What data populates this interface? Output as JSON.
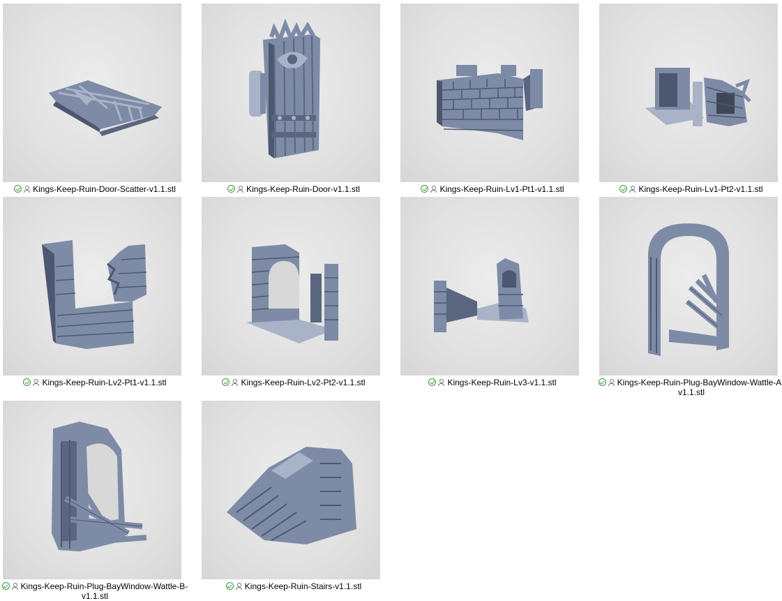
{
  "files": [
    {
      "name": "Kings-Keep-Ruin-Door-Scatter-v1.1.stl",
      "status_icon": "sync-ok-icon",
      "owner_icon": "person-icon",
      "thumb": "door-scatter"
    },
    {
      "name": "Kings-Keep-Ruin-Door-v1.1.stl",
      "status_icon": "sync-ok-icon",
      "owner_icon": "person-icon",
      "thumb": "door"
    },
    {
      "name": "Kings-Keep-Ruin-Lv1-Pt1-v1.1.stl",
      "status_icon": "sync-ok-icon",
      "owner_icon": "person-icon",
      "thumb": "lv1-pt1"
    },
    {
      "name": "Kings-Keep-Ruin-Lv1-Pt2-v1.1.stl",
      "status_icon": "sync-ok-icon",
      "owner_icon": "person-icon",
      "thumb": "lv1-pt2"
    },
    {
      "name": "Kings-Keep-Ruin-Lv2-Pt1-v1.1.stl",
      "status_icon": "sync-ok-icon",
      "owner_icon": "person-icon",
      "thumb": "lv2-pt1"
    },
    {
      "name": "Kings-Keep-Ruin-Lv2-Pt2-v1.1.stl",
      "status_icon": "sync-ok-icon",
      "owner_icon": "person-icon",
      "thumb": "lv2-pt2"
    },
    {
      "name": "Kings-Keep-Ruin-Lv3-v1.1.stl",
      "status_icon": "sync-ok-icon",
      "owner_icon": "person-icon",
      "thumb": "lv3"
    },
    {
      "name": "Kings-Keep-Ruin-Plug-BayWindow-Wattle-A-v1.1.stl",
      "status_icon": "sync-ok-icon",
      "owner_icon": "person-icon",
      "thumb": "bay-window-a"
    },
    {
      "name": "Kings-Keep-Ruin-Plug-BayWindow-Wattle-B-v1.1.stl",
      "status_icon": "sync-ok-icon",
      "owner_icon": "person-icon",
      "thumb": "bay-window-b"
    },
    {
      "name": "Kings-Keep-Ruin-Stairs-v1.1.stl",
      "status_icon": "sync-ok-icon",
      "owner_icon": "person-icon",
      "thumb": "stairs"
    }
  ],
  "colors": {
    "model_fill": "#7e8ba6",
    "model_shadow": "#4d5770",
    "model_highlight": "#a9b3c8",
    "status_ok": "#3a9a3a"
  }
}
